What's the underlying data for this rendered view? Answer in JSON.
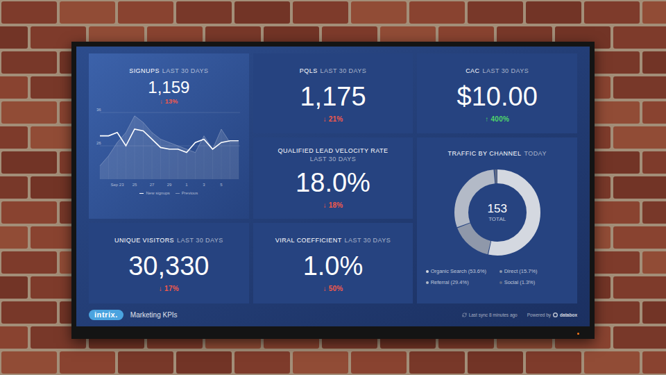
{
  "dashboard": {
    "logo": "intrix.",
    "title": "Marketing KPIs",
    "sync": "Last sync 8 minutes ago",
    "powered_by": "Powered by",
    "provider": "databox"
  },
  "signups": {
    "title": "SIGNUPS",
    "period": "LAST 30 DAYS",
    "value": "1,159",
    "trend": "↓ 13%",
    "direction": "down",
    "chart": {
      "y_ticks": [
        {
          "label": "36",
          "value": 36
        },
        {
          "label": "26",
          "value": 26
        }
      ],
      "x_labels": [
        "Sep 23",
        "25",
        "27",
        "29",
        "1",
        "3",
        "5"
      ],
      "series": [
        {
          "name": "New signups",
          "values": [
            29,
            29,
            30,
            26,
            31,
            30.5,
            28,
            25.5,
            25,
            25,
            24,
            27,
            28,
            25,
            27,
            27.5,
            27.5
          ]
        },
        {
          "name": "Previous",
          "values": [
            20,
            23,
            27,
            30,
            35,
            33,
            30,
            28,
            27,
            26,
            25,
            24,
            29,
            25,
            31,
            27,
            27
          ]
        }
      ]
    }
  },
  "kpis": [
    {
      "title": "PQLS",
      "period": "LAST 30 DAYS",
      "value": "1,175",
      "trend": "↓ 21%",
      "direction": "down",
      "kind": "inline"
    },
    {
      "title": "CAC",
      "period": "LAST 30 DAYS",
      "value": "$10.00",
      "trend": "↑ 400%",
      "direction": "up",
      "kind": "inline"
    },
    {
      "title": "QUALIFIED LEAD VELOCITY RATE",
      "period": "LAST 30 DAYS",
      "value": "18.0%",
      "trend": "↓ 18%",
      "direction": "down",
      "kind": "stacked"
    },
    {
      "title": "UNIQUE VISITORS",
      "period": "LAST 30 DAYS",
      "value": "30,330",
      "trend": "↓ 17%",
      "direction": "down",
      "kind": "inline"
    },
    {
      "title": "VIRAL COEFFICIENT",
      "period": "LAST 30 DAYS",
      "value": "1.0%",
      "trend": "↓ 50%",
      "direction": "down",
      "kind": "inline"
    }
  ],
  "traffic": {
    "title": "TRAFFIC BY CHANNEL",
    "period": "TODAY",
    "total": "153",
    "total_label": "TOTAL",
    "channels": [
      {
        "label": "Organic Search (53.6%)",
        "level": 0.536,
        "color": "#d4d8e0"
      },
      {
        "label": "Direct (15.7%)",
        "level": 0.157,
        "color": "#8f98aa"
      },
      {
        "label": "Referral (29.4%)",
        "level": 0.294,
        "color": "#b3bac7"
      },
      {
        "label": "Social (1.3%)",
        "level": 0.013,
        "color": "#5e6a85"
      }
    ]
  }
}
